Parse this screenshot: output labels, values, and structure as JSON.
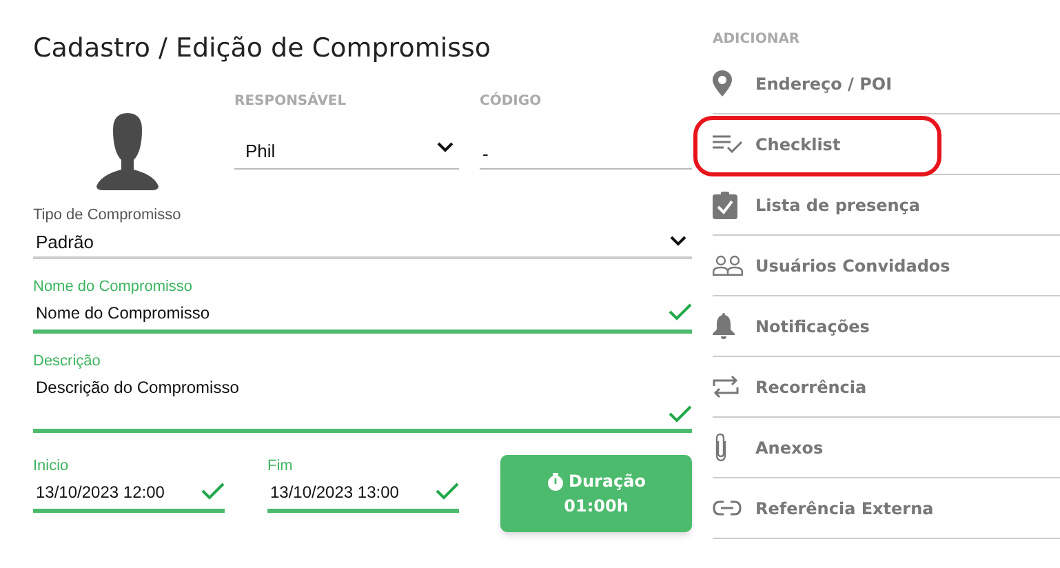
{
  "title": "Cadastro / Edição de Compromisso",
  "responsavel": {
    "label": "RESPONSÁVEL",
    "value": "Phil"
  },
  "codigo": {
    "label": "CÓDIGO",
    "value": "-"
  },
  "tipo": {
    "label": "Tipo de Compromisso",
    "value": "Padrão"
  },
  "nome": {
    "label": "Nome do Compromisso",
    "value": "Nome do Compromisso",
    "valid": true
  },
  "descricao": {
    "label": "Descrição",
    "value": "Descrição do Compromisso",
    "valid": true
  },
  "inicio": {
    "label": "Inicio",
    "value": "13/10/2023 12:00",
    "valid": true
  },
  "fim": {
    "label": "Fim",
    "value": "13/10/2023 13:00",
    "valid": true
  },
  "duracao": {
    "label": "Duração",
    "value": "01:00h"
  },
  "sidebar": {
    "heading": "ADICIONAR",
    "items": [
      {
        "kind": "pin",
        "label": "Endereço / POI",
        "highlighted": false
      },
      {
        "kind": "checklist",
        "label": "Checklist",
        "highlighted": true
      },
      {
        "kind": "clipboard",
        "label": "Lista de presença",
        "highlighted": false
      },
      {
        "kind": "users",
        "label": "Usuários Convidados",
        "highlighted": false
      },
      {
        "kind": "bell",
        "label": "Notificações",
        "highlighted": false
      },
      {
        "kind": "repeat",
        "label": "Recorrência",
        "highlighted": false
      },
      {
        "kind": "clip",
        "label": "Anexos",
        "highlighted": false
      },
      {
        "kind": "link",
        "label": "Referência Externa",
        "highlighted": false
      }
    ]
  }
}
